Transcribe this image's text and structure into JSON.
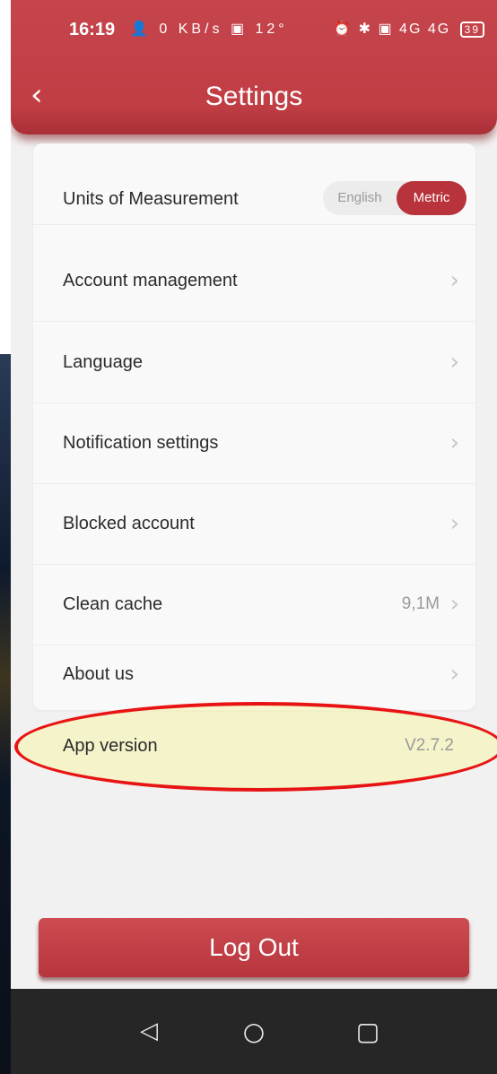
{
  "status_bar": {
    "time": "16:19",
    "left_icons": "👤 0 KB/s ▣ 12°",
    "right_icons": "⏰ ✱ ▣ 4G 4G",
    "battery": "39"
  },
  "header": {
    "back_icon": "chevron-left-icon",
    "title": "Settings"
  },
  "settings": {
    "units": {
      "label": "Units of Measurement",
      "options": [
        "English",
        "Metric"
      ],
      "selected": "Metric"
    },
    "rows": [
      {
        "label": "Account management",
        "value": "",
        "chevron": true
      },
      {
        "label": "Language",
        "value": "",
        "chevron": true
      },
      {
        "label": "Notification settings",
        "value": "",
        "chevron": true
      },
      {
        "label": "Blocked account",
        "value": "",
        "chevron": true
      },
      {
        "label": "Clean cache",
        "value": "9,1M",
        "chevron": true
      },
      {
        "label": "About us",
        "value": "",
        "chevron": true
      },
      {
        "label": "App version",
        "value": "V2.7.2",
        "chevron": false
      }
    ]
  },
  "logout_label": "Log Out",
  "nav": {
    "back": "◁",
    "home": "○",
    "recent": "▢"
  },
  "colors": {
    "brand": "#c03d44",
    "annotation": "#e81414",
    "highlight": "#f6f4a8"
  }
}
